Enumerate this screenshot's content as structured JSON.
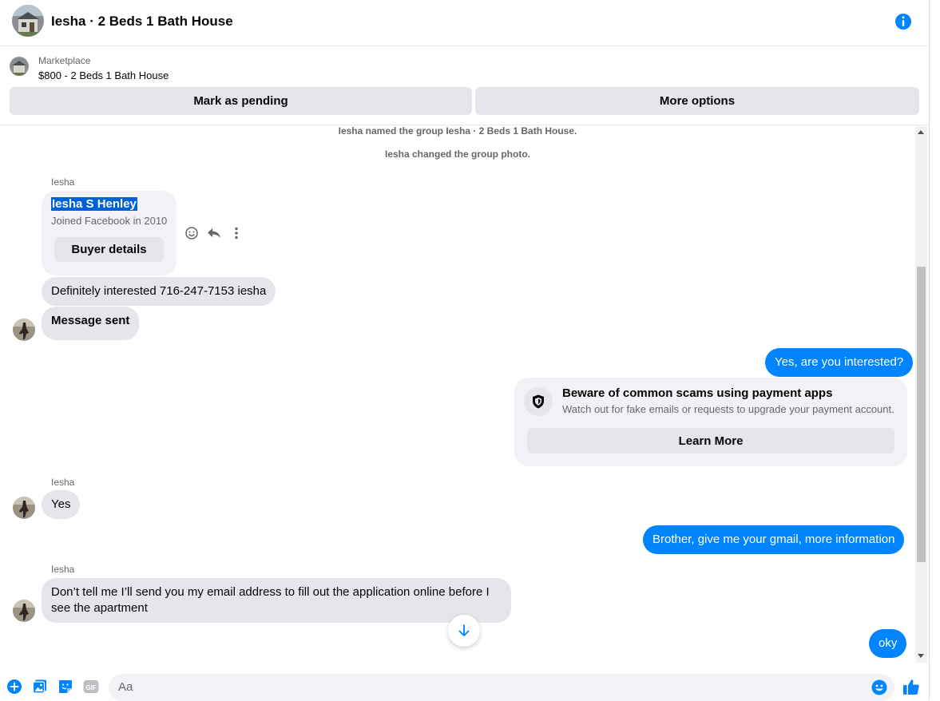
{
  "header": {
    "title": "Iesha · 2 Beds 1 Bath House",
    "info_icon": "info-icon"
  },
  "listing": {
    "label": "Marketplace",
    "title": "$800 - 2 Beds 1 Bath House",
    "pending_label": "Mark as pending",
    "more_label": "More options"
  },
  "messages": {
    "system": [
      "Iesha named the group Iesha · 2 Beds 1 Bath House.",
      "Iesha changed the group photo."
    ],
    "sender": "Iesha",
    "card": {
      "name": "Iesha S Henley",
      "joined": "Joined Facebook in 2010",
      "button": "Buyer details"
    },
    "m1": "Definitely interested 716-247-7153 iesha",
    "m2": "Message sent",
    "m3": "Yes, are you interested?",
    "scam": {
      "heading": "Beware of common scams using payment apps",
      "sub": "Watch out for fake emails or requests to upgrade your payment account.",
      "button": "Learn More"
    },
    "m4": "Yes",
    "m5": "Brother, give me your gmail, more information",
    "m6_line1": "Don’t tell me I’ll send you my email address to fill out the application online before I",
    "m6_line2": "see the apartment",
    "m7": "oky"
  },
  "composer": {
    "placeholder": "Aa",
    "icons": [
      "plus-icon",
      "photo-icon",
      "sticker-icon",
      "gif-icon",
      "emoji-icon",
      "like-icon"
    ]
  },
  "colors": {
    "accent": "#0084ff",
    "bubble_grey": "#e4e6eb",
    "secondary_text": "#65676b"
  }
}
